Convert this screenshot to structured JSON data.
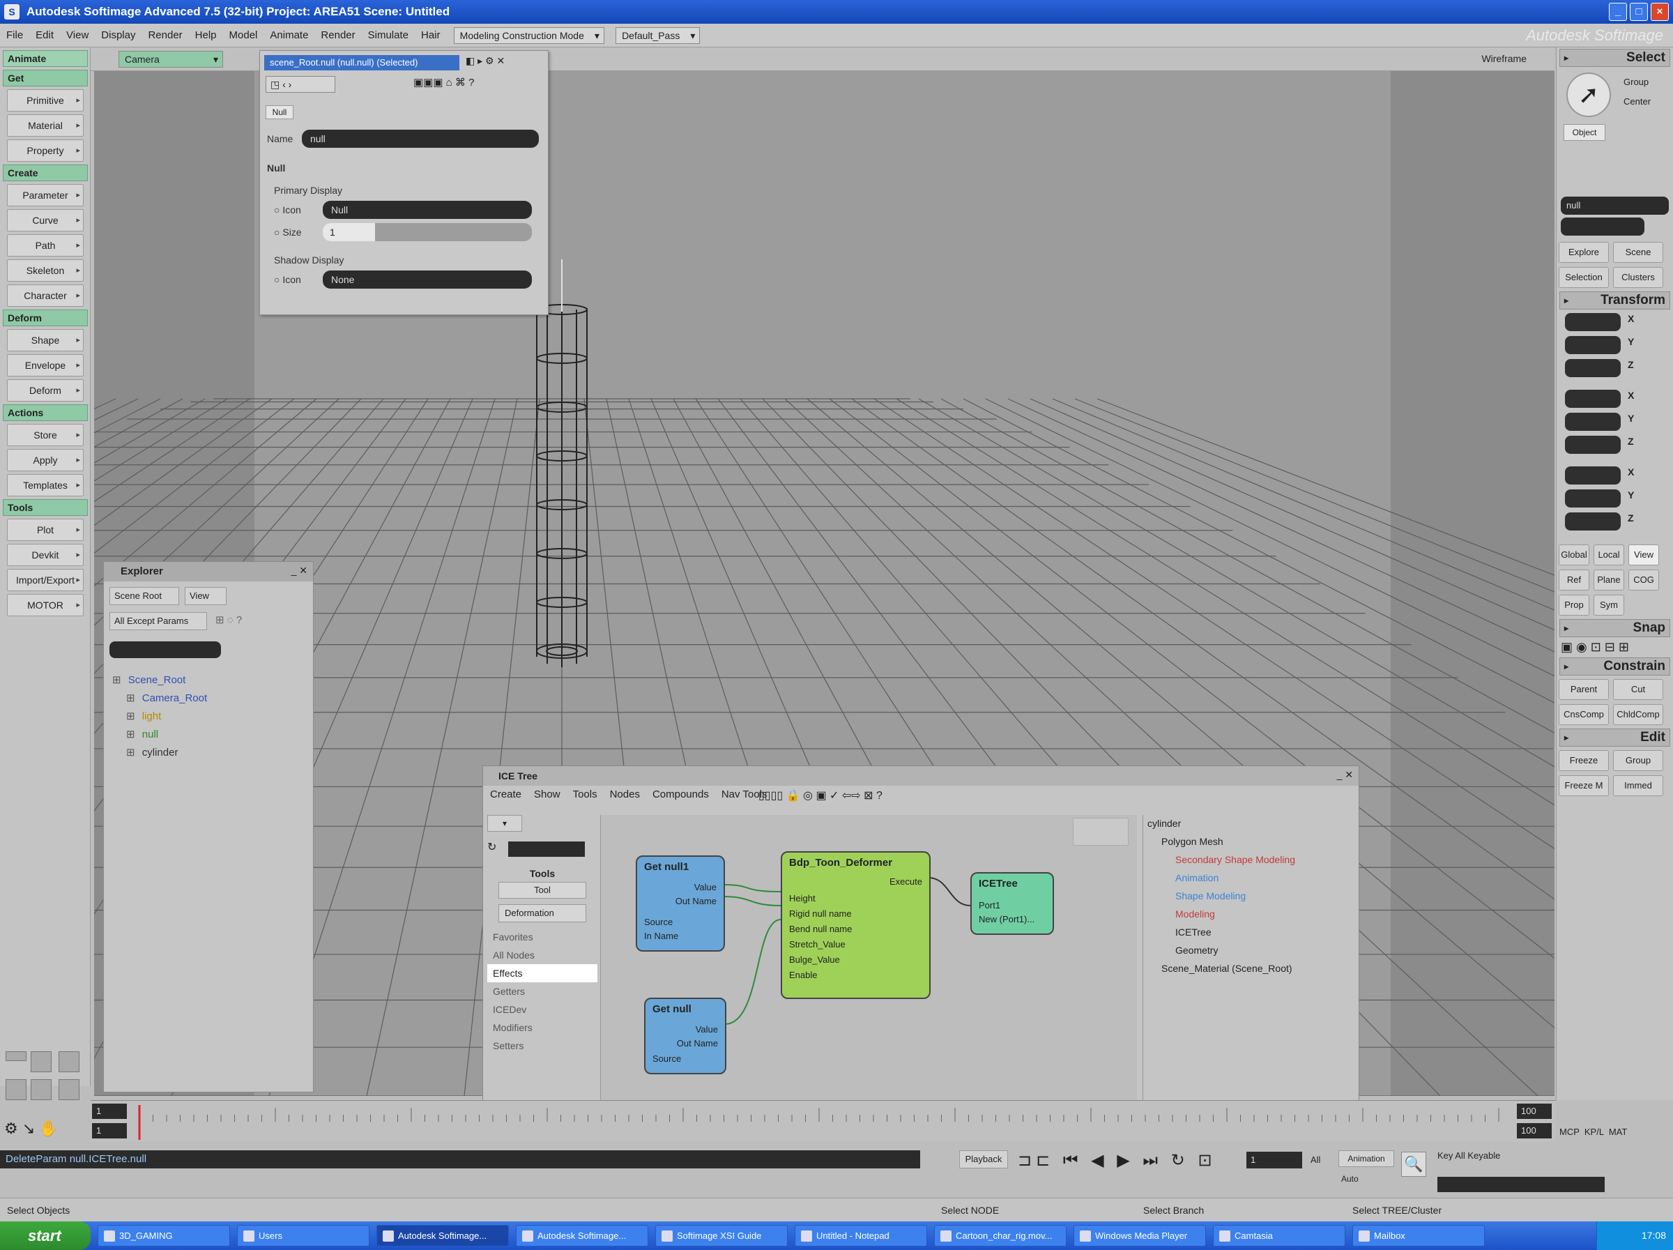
{
  "window": {
    "title": "Autodesk Softimage Advanced 7.5 (32-bit)   Project: AREA51   Scene: Untitled",
    "brand": "Autodesk Softimage"
  },
  "menubar": {
    "items": [
      "File",
      "Edit",
      "View",
      "Display",
      "Render",
      "Help",
      "Model",
      "Animate",
      "Render",
      "Simulate",
      "Hair"
    ],
    "layout": "Modeling Construction Mode",
    "pass": "Default_Pass"
  },
  "left_toolbar": {
    "top_dropdown": "Animate",
    "sections": [
      {
        "title": "Get",
        "buttons": [
          "Primitive",
          "Material",
          "Property"
        ]
      },
      {
        "title": "Create",
        "buttons": [
          "Parameter",
          "Curve",
          "Path",
          "Skeleton",
          "Character"
        ]
      },
      {
        "title": "Deform",
        "buttons": [
          "Shape",
          "Envelope",
          "Deform"
        ]
      },
      {
        "title": "Actions",
        "buttons": [
          "Store",
          "Apply",
          "Templates"
        ]
      },
      {
        "title": "Tools",
        "buttons": [
          "Plot",
          "Devkit",
          "Import/Export",
          "MOTOR"
        ]
      }
    ]
  },
  "viewport": {
    "camera": "Camera",
    "mode": "Wireframe"
  },
  "property_panel": {
    "tab": "scene_Root.null (null.null) (Selected)",
    "section_tab": "Null",
    "name_label": "Name",
    "name_value": "null",
    "group": "Null",
    "primary_display": "Primary Display",
    "icon_label": "Icon",
    "icon_value": "Null",
    "size_label": "Size",
    "size_value": "1",
    "size_fraction": 0.25,
    "shadow_display": "Shadow Display",
    "shadow_label": "Icon",
    "shadow_value": "None"
  },
  "explorer": {
    "title": "Explorer",
    "scope": "Scene Root",
    "view": "View",
    "filter": "All Except Params",
    "items": [
      {
        "label": "Scene_Root",
        "color": "#2f4fb0"
      },
      {
        "label": "Camera_Root",
        "color": "#2f4fb0"
      },
      {
        "label": "light",
        "color": "#b58a00"
      },
      {
        "label": "null",
        "color": "#2a8a2a"
      },
      {
        "label": "cylinder",
        "color": "#333333"
      }
    ]
  },
  "ice_tree": {
    "title": "ICE Tree",
    "menu": [
      "Create",
      "Show",
      "Tools",
      "Nodes",
      "Compounds",
      "Nav Tools"
    ],
    "left": {
      "tools_label": "Tools",
      "tool": "Tool",
      "category": "Deformation",
      "presets": [
        "Favorites",
        "All Nodes",
        "Effects",
        "Getters",
        "ICEDev",
        "Modifiers",
        "Setters"
      ],
      "selected_preset": "Effects"
    },
    "nodes": {
      "get_null1": {
        "title": "Get null1",
        "ports_out": [
          "Value",
          "Out Name"
        ],
        "ports_in": [
          "Source",
          "In Name"
        ]
      },
      "get_null2": {
        "title": "Get null",
        "ports_out": [
          "Value",
          "Out Name"
        ],
        "ports_in": [
          "Source"
        ]
      },
      "deformer": {
        "title": "Bdp_Toon_Deformer",
        "out": "Execute",
        "ports_in": [
          "Height",
          "Rigid null name",
          "Bend null name",
          "Stretch_Value",
          "Bulge_Value",
          "Enable"
        ]
      },
      "icetree": {
        "title": "ICETree",
        "ports_in": [
          "Port1",
          "New (Port1)..."
        ]
      }
    },
    "tree": [
      {
        "label": "cylinder",
        "color": "#222"
      },
      {
        "label": "Polygon Mesh",
        "color": "#222"
      },
      {
        "label": "Secondary Shape Modeling",
        "color": "#c23a3a"
      },
      {
        "label": "Animation",
        "color": "#3e82d6"
      },
      {
        "label": "Shape Modeling",
        "color": "#3e82d6"
      },
      {
        "label": "Modeling",
        "color": "#c23a3a"
      },
      {
        "label": "ICETree",
        "color": "#222"
      },
      {
        "label": "Geometry",
        "color": "#222"
      },
      {
        "label": "Scene_Material (Scene_Root)",
        "color": "#222"
      }
    ]
  },
  "right_panel": {
    "select_title": "Select",
    "group": "Group",
    "center": "Center",
    "object": "Object",
    "selection_name": "null",
    "explore": "Explore",
    "scene": "Scene",
    "selection": "Selection",
    "clusters": "Clusters",
    "transform_title": "Transform",
    "axes": [
      "X",
      "Y",
      "Z"
    ],
    "modes": [
      "Global",
      "Local",
      "View"
    ],
    "ref": "Ref",
    "plane": "Plane",
    "cog": "COG",
    "prop": "Prop",
    "sym": "Sym",
    "snap_title": "Snap",
    "constrain_title": "Constrain",
    "parent": "Parent",
    "cut": "Cut",
    "cnscomp": "CnsComp",
    "chldcomp": "ChldComp",
    "edit_title": "Edit",
    "freeze": "Freeze",
    "group2": "Group",
    "freeze_m": "Freeze M",
    "immed": "Immed",
    "mcp": "MCP",
    "kp": "KP/L",
    "mat": "MAT"
  },
  "timeline": {
    "start": "1",
    "end": "100",
    "current": "1"
  },
  "command_line": "DeleteParam null.ICETree.null",
  "playback": {
    "label": "Playback",
    "frame": "1",
    "all": "All",
    "animation": "Animation",
    "auto": "Auto",
    "key_all": "Key All Keyable"
  },
  "status": {
    "left": "Select Objects",
    "m1": "Select NODE",
    "m2": "Select Branch",
    "m3": "Select TREE/Cluster"
  },
  "taskbar": {
    "start": "start",
    "tasks": [
      "3D_GAMING",
      "Users",
      "Autodesk Softimage...",
      "Autodesk Softimage...",
      "Softimage XSI Guide",
      "Untitled - Notepad",
      "Cartoon_char_rig.mov...",
      "Windows Media Player",
      "Camtasia",
      "Mailbox"
    ],
    "active_index": 2,
    "clock": "17:08"
  }
}
